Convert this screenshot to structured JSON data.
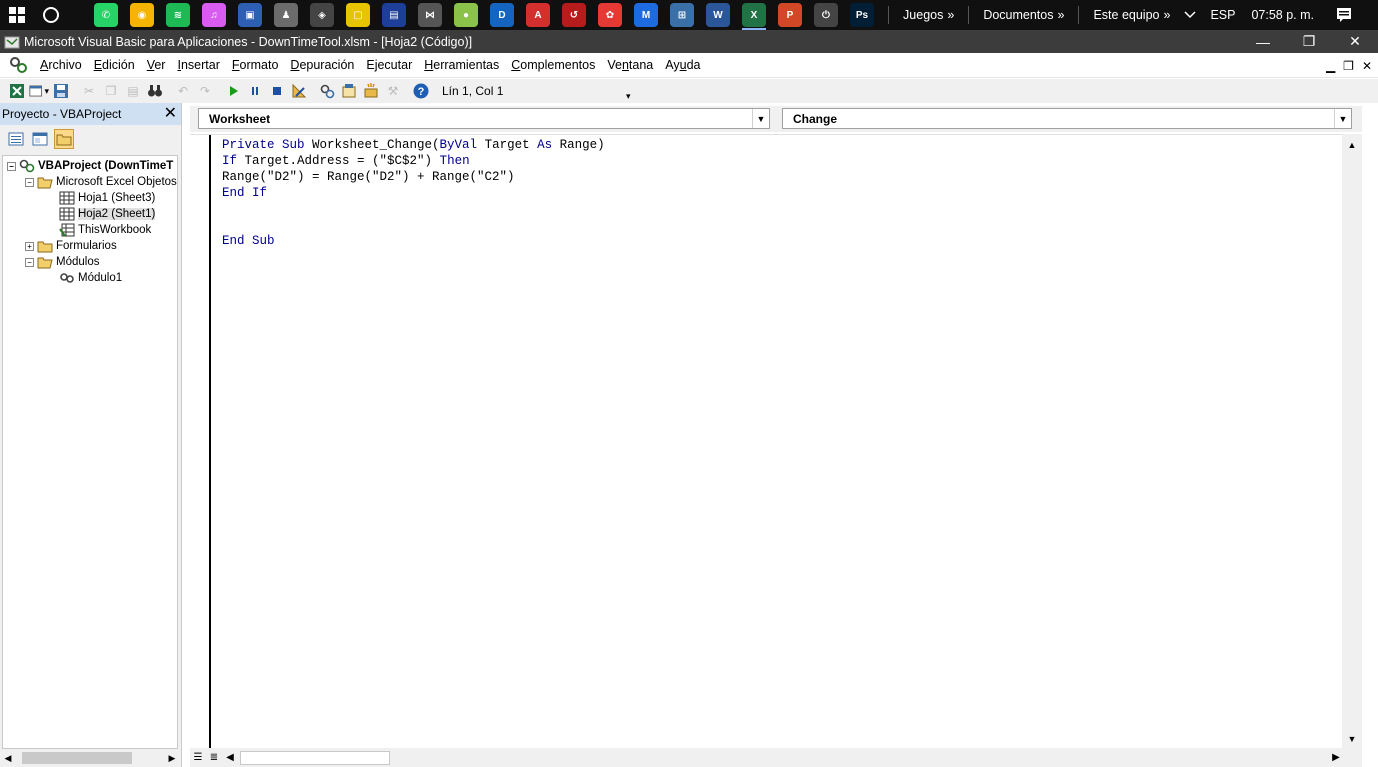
{
  "taskbar": {
    "apps": [
      {
        "name": "whatsapp-icon",
        "color": "#25d366",
        "glyph": "✆"
      },
      {
        "name": "chrome-icon",
        "color": "#f4b400",
        "glyph": "◉"
      },
      {
        "name": "spotify-icon",
        "color": "#1db954",
        "glyph": "≋"
      },
      {
        "name": "itunes-icon",
        "color": "#d95cf0",
        "glyph": "♫"
      },
      {
        "name": "app-icon-blue",
        "color": "#2f5fb3",
        "glyph": "▣"
      },
      {
        "name": "app-icon-person",
        "color": "#6b6b6b",
        "glyph": "♟"
      },
      {
        "name": "app-icon-cube",
        "color": "#444444",
        "glyph": "◈"
      },
      {
        "name": "app-icon-yellow-square",
        "color": "#e7c300",
        "glyph": "▢"
      },
      {
        "name": "app-icon-blue-logo",
        "color": "#1e3f99",
        "glyph": "▤"
      },
      {
        "name": "app-icon-network",
        "color": "#555555",
        "glyph": "⋈"
      },
      {
        "name": "app-icon-green-lock",
        "color": "#8bc34a",
        "glyph": "●"
      },
      {
        "name": "app-icon-blue-d",
        "color": "#1565c0",
        "glyph": "D"
      },
      {
        "name": "acrobat-icon",
        "color": "#d32f2f",
        "glyph": "A"
      },
      {
        "name": "app-icon-red-arrow",
        "color": "#b71c1c",
        "glyph": "↺"
      },
      {
        "name": "app-icon-colors",
        "color": "#e53935",
        "glyph": "✿"
      },
      {
        "name": "app-icon-m",
        "color": "#1e6be0",
        "glyph": "M"
      },
      {
        "name": "app-icon-remote",
        "color": "#3b6fa8",
        "glyph": "⊞"
      },
      {
        "name": "word-icon",
        "color": "#2b579a",
        "glyph": "W"
      },
      {
        "name": "excel-icon",
        "color": "#217346",
        "glyph": "X"
      },
      {
        "name": "powerpoint-icon",
        "color": "#d24726",
        "glyph": "P"
      },
      {
        "name": "app-icon-plug",
        "color": "#444444",
        "glyph": "⏻"
      },
      {
        "name": "photoshop-icon",
        "color": "#001e36",
        "glyph": "Ps"
      }
    ],
    "toolbars": [
      "Juegos",
      "Documentos",
      "Este equipo"
    ],
    "language": "ESP",
    "clock": "07:58 p. m."
  },
  "window": {
    "title": "Microsoft Visual Basic para Aplicaciones - DownTimeTool.xlsm - [Hoja2 (Código)]"
  },
  "menu": {
    "items": [
      {
        "pre": "",
        "u": "A",
        "post": "rchivo"
      },
      {
        "pre": "",
        "u": "E",
        "post": "dición"
      },
      {
        "pre": "",
        "u": "V",
        "post": "er"
      },
      {
        "pre": "",
        "u": "I",
        "post": "nsertar"
      },
      {
        "pre": "",
        "u": "F",
        "post": "ormato"
      },
      {
        "pre": "",
        "u": "D",
        "post": "epuración"
      },
      {
        "pre": "E",
        "u": "j",
        "post": "ecutar"
      },
      {
        "pre": "",
        "u": "H",
        "post": "erramientas"
      },
      {
        "pre": "",
        "u": "C",
        "post": "omplementos"
      },
      {
        "pre": "Ve",
        "u": "n",
        "post": "tana"
      },
      {
        "pre": "Ay",
        "u": "u",
        "post": "da"
      }
    ]
  },
  "toolbar": {
    "cursor_position": "Lín 1, Col 1"
  },
  "project": {
    "title": "Proyecto - VBAProject",
    "tree": {
      "root": "VBAProject (DownTimeT",
      "excel_objects": "Microsoft Excel Objetos",
      "sheet1": "Hoja1 (Sheet3)",
      "sheet2": "Hoja2 (Sheet1)",
      "workbook": "ThisWorkbook",
      "forms": "Formularios",
      "modules": "Módulos",
      "module1": "Módulo1"
    }
  },
  "code": {
    "object_combo": "Worksheet",
    "procedure_combo": "Change"
  }
}
